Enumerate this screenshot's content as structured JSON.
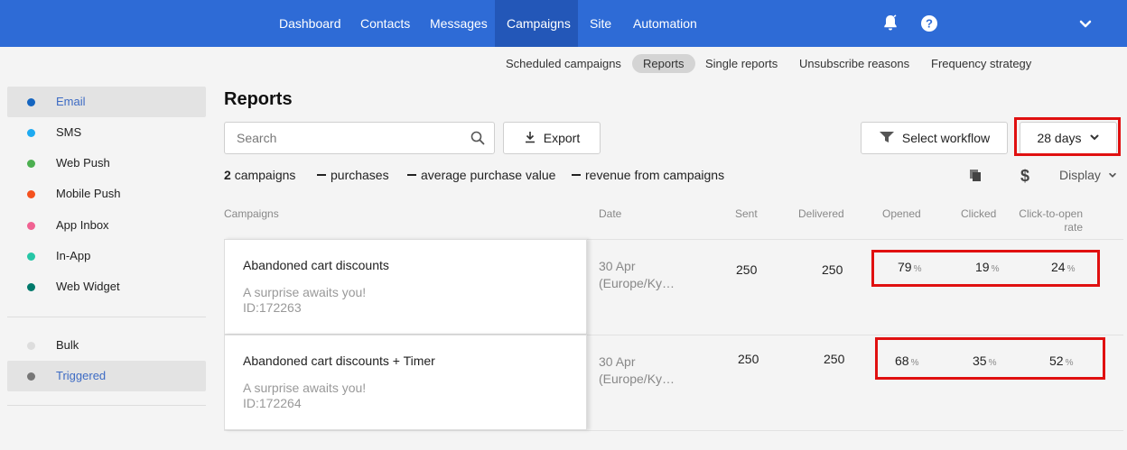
{
  "nav": {
    "items": [
      {
        "label": "Dashboard"
      },
      {
        "label": "Contacts"
      },
      {
        "label": "Messages"
      },
      {
        "label": "Campaigns"
      },
      {
        "label": "Site"
      },
      {
        "label": "Automation"
      }
    ],
    "active": "Campaigns",
    "icons": [
      "bell-icon",
      "help-icon",
      "chevron-down-icon"
    ]
  },
  "subnav": {
    "items": [
      {
        "label": "Scheduled campaigns"
      },
      {
        "label": "Reports"
      },
      {
        "label": "Single reports"
      },
      {
        "label": "Unsubscribe reasons"
      },
      {
        "label": "Frequency strategy"
      }
    ],
    "active": "Reports"
  },
  "sidebar": {
    "channels": [
      {
        "label": "Email",
        "color": "#1565c0"
      },
      {
        "label": "SMS",
        "color": "#1eaaf1"
      },
      {
        "label": "Web Push",
        "color": "#4caf50"
      },
      {
        "label": "Mobile Push",
        "color": "#f4511e"
      },
      {
        "label": "App Inbox",
        "color": "#f06292"
      },
      {
        "label": "In-App",
        "color": "#26c6a6"
      },
      {
        "label": "Web Widget",
        "color": "#00796b"
      }
    ],
    "types": [
      {
        "label": "Bulk",
        "color": "#dddddd"
      },
      {
        "label": "Triggered",
        "color": "#777777"
      }
    ]
  },
  "page": {
    "title": "Reports"
  },
  "toolbar": {
    "search_placeholder": "Search",
    "export_label": "Export",
    "workflow_label": "Select workflow",
    "period_label": "28 days"
  },
  "summary": {
    "campaigns_count": "2",
    "campaigns_label": "campaigns",
    "purchases_label": "purchases",
    "avg_purchase_label": "average purchase value",
    "revenue_label": "revenue from campaigns",
    "display_label": "Display"
  },
  "table": {
    "headers": {
      "campaigns": "Campaigns",
      "date": "Date",
      "sent": "Sent",
      "delivered": "Delivered",
      "opened": "Opened",
      "clicked": "Clicked",
      "cto_line1": "Click-to-open",
      "cto_line2": "rate"
    },
    "rows": [
      {
        "name": "Abandoned cart discounts",
        "description": "A surprise awaits you!",
        "id": "ID:172263",
        "date_line1": "30 Apr",
        "date_line2": "(Europe/Ky…",
        "sent": "250",
        "delivered": "250",
        "opened": "79",
        "clicked": "19",
        "cto": "24"
      },
      {
        "name": "Abandoned cart discounts + Timer",
        "description": "A surprise awaits you!",
        "id": "ID:172264",
        "date_line1": "30 Apr",
        "date_line2": "(Europe/Ky…",
        "sent": "250",
        "delivered": "250",
        "opened": "68",
        "clicked": "35",
        "cto": "52"
      }
    ],
    "percent_sign": "%"
  }
}
